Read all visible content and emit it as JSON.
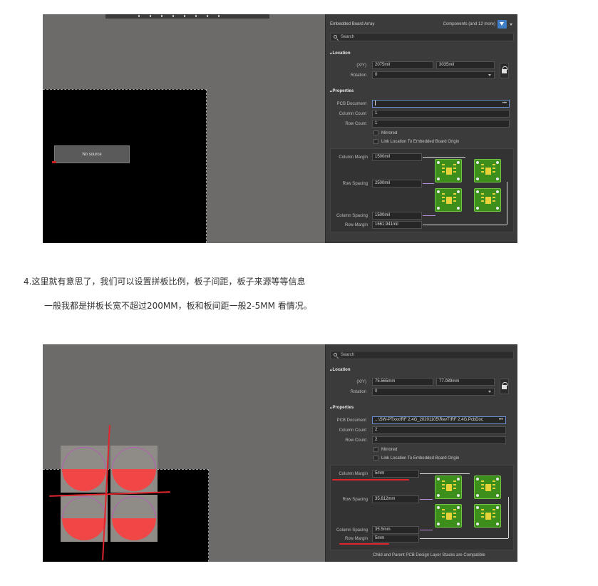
{
  "colors": {
    "accent_red": "#e0252d",
    "panel_bg": "#3b3b3b",
    "canvas_bg": "#6d6b69",
    "filter_blue": "#3f7ec7",
    "board_green": "#3c8f1b"
  },
  "screenshot1": {
    "canvas": {
      "no_source": "No source"
    },
    "panel": {
      "title": "Embedded Board Array",
      "filter": "Components (and 12 more)",
      "filter_icon": "filter-icon",
      "search_placeholder": "Search",
      "location_header": "Location",
      "xy_label": "(X/Y)",
      "x_value": "2075mil",
      "y_value": "3035mil",
      "rotation_label": "Rotation",
      "rotation_value": "0",
      "properties_header": "Properties",
      "pcb_document_label": "PCB Document",
      "pcb_document_value": "",
      "more_button": "•••",
      "column_count_label": "Column Count",
      "column_count_value": "1",
      "row_count_label": "Row Count",
      "row_count_value": "1",
      "mirrored_label": "Mirrored",
      "link_label": "Link Location To Embedded Board Origin",
      "column_margin_label": "Column Margin",
      "column_margin_value": "1500mil",
      "row_spacing_label": "Row Spacing",
      "row_spacing_value": "2500mil",
      "column_spacing_label": "Column Spacing",
      "column_spacing_value": "1500mil",
      "row_margin_label": "Row Margin",
      "row_margin_value": "1661.941mil"
    }
  },
  "article": {
    "line1": "4.这里就有意思了，我们可以设置拼板比例，板子间距，板子来源等等信息",
    "line2": "一般我都是拼板长宽不超过200MM，板和板间距一般2-5MM 看情况。"
  },
  "screenshot2": {
    "panel": {
      "search_placeholder": "Search",
      "location_header": "Location",
      "xy_label": "(X/Y)",
      "x_value": "75.565mm",
      "y_value": "77.089mm",
      "rotation_label": "Rotation",
      "rotation_value": "0",
      "properties_header": "Properties",
      "pcb_document_label": "PCB Document",
      "pcb_document_value": "...\\SW-PTxxx\\RF 2.4G_20201105\\RevT\\RF 2.4G.PcbDoc",
      "more_button": "•••",
      "column_count_label": "Column Count",
      "column_count_value": "2",
      "row_count_label": "Row Count",
      "row_count_value": "2",
      "mirrored_label": "Mirrored",
      "link_label": "Link Location To Embedded Board Origin",
      "column_margin_label": "Column Margin",
      "column_margin_value": "5mm",
      "row_spacing_label": "Row Spacing",
      "row_spacing_value": "35.612mm",
      "column_spacing_label": "Column Spacing",
      "column_spacing_value": "35.5mm",
      "row_margin_label": "Row Margin",
      "row_margin_value": "5mm",
      "footer_note": "Child and Parent PCB Design Layer Stacks are Compatible"
    }
  }
}
